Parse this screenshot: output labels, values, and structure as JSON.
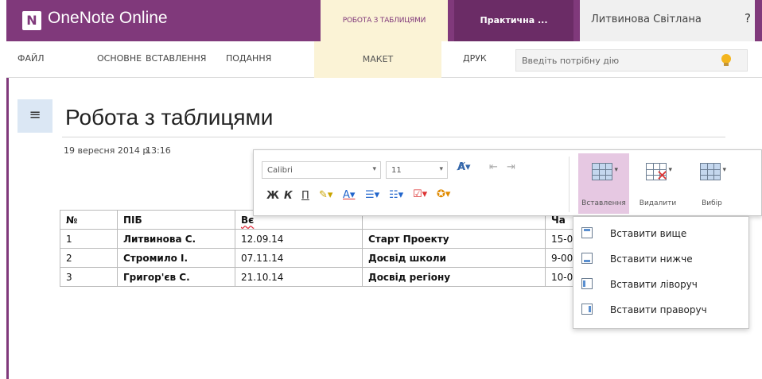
{
  "app": {
    "logo": "N",
    "name": "OneNote Online"
  },
  "titlebar": {
    "context_tab": "РОБОТА З ТАБЛИЦЯМИ",
    "notebook": "Практична ...",
    "user_name": "Литвинова Світлана",
    "help": "?"
  },
  "ribbon": {
    "tabs": [
      "ФАЙЛ",
      "ОСНОВНЕ",
      "ВСТАВЛЕННЯ",
      "ПОДАННЯ",
      "МАКЕТ",
      "ДРУК"
    ],
    "active_tab": "МАКЕТ",
    "tell_me_placeholder": "Введіть потрібну дію"
  },
  "nav_toggle": "≡",
  "page": {
    "title": "Робота з таблицями",
    "date": "19 вересня 2014 р.",
    "time": "13:16"
  },
  "table": {
    "headers": [
      "№",
      "ПІБ",
      "Вє",
      "",
      "Ча"
    ],
    "rows": [
      [
        "1",
        "Литвинова С.",
        "12.09.14",
        "Старт Проекту",
        "15-0"
      ],
      [
        "2",
        "Стромило І.",
        "07.11.14",
        "Досвід школи",
        "9-00"
      ],
      [
        "3",
        "Григор'єв С.",
        "21.10.14",
        "Досвід регіону",
        "10-0"
      ]
    ]
  },
  "toolbar": {
    "font_name": "Calibri",
    "font_size": "11",
    "bold": "Ж",
    "italic": "К",
    "underline": "П",
    "insert_label": "Вставлення",
    "delete_label": "Видалити",
    "select_label": "Вибір"
  },
  "insert_menu": {
    "items": [
      "Вставити вище",
      "Вставити нижче",
      "Вставити ліворуч",
      "Вставити праворуч"
    ]
  },
  "colors": {
    "brand": "#80397b",
    "context_tab_bg": "#fbf3d6",
    "active_button_bg": "#e6c8e2"
  },
  "icons": [
    "onenote-logo-icon",
    "hamburger-icon",
    "lightbulb-icon",
    "insert-table-icon",
    "delete-table-icon",
    "select-table-icon"
  ]
}
